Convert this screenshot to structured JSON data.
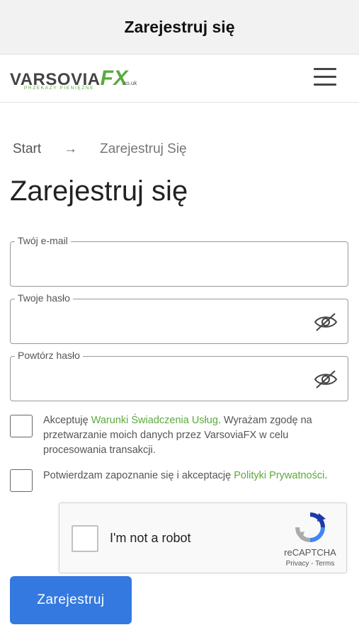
{
  "titlebar": {
    "title": "Zarejestruj się"
  },
  "logo": {
    "word": "VARSOVIA",
    "fx": "FX",
    "tld": ".co.uk",
    "tagline": "PRZEKAZY PIENIĘŻNE"
  },
  "header": {
    "menu_icon": "hamburger-menu-icon"
  },
  "breadcrumb": {
    "home": "Start",
    "separator": "→",
    "current": "Zarejestruj Się"
  },
  "page": {
    "title": "Zarejestruj się"
  },
  "form": {
    "email": {
      "label": "Twój e-mail",
      "value": ""
    },
    "password": {
      "label": "Twoje hasło",
      "value": "",
      "icon": "eye-slash-icon"
    },
    "password_repeat": {
      "label": "Powtórz hasło",
      "value": "",
      "icon": "eye-slash-icon"
    },
    "terms": {
      "prefix": "Akceptuję ",
      "link": "Warunki Świadczenia Usług",
      "suffix": ". Wyrażam zgodę na przetwarzanie moich danych przez VarsoviaFX w celu procesowania transakcji.",
      "checked": false
    },
    "privacy": {
      "prefix": "Potwierdzam zapoznanie się i akceptację ",
      "link": "Polityki Prywatności",
      "suffix": ".",
      "checked": false
    }
  },
  "recaptcha": {
    "label": "I'm not a robot",
    "brand": "reCAPTCHA",
    "privacy": "Privacy",
    "dash": " - ",
    "terms": "Terms",
    "logo_icon": "recaptcha-logo-icon"
  },
  "submit": {
    "label": "Zarejestruj"
  },
  "colors": {
    "brand_green": "#5aaa3c",
    "button_blue": "#3479e0",
    "text_grey": "#555555"
  }
}
